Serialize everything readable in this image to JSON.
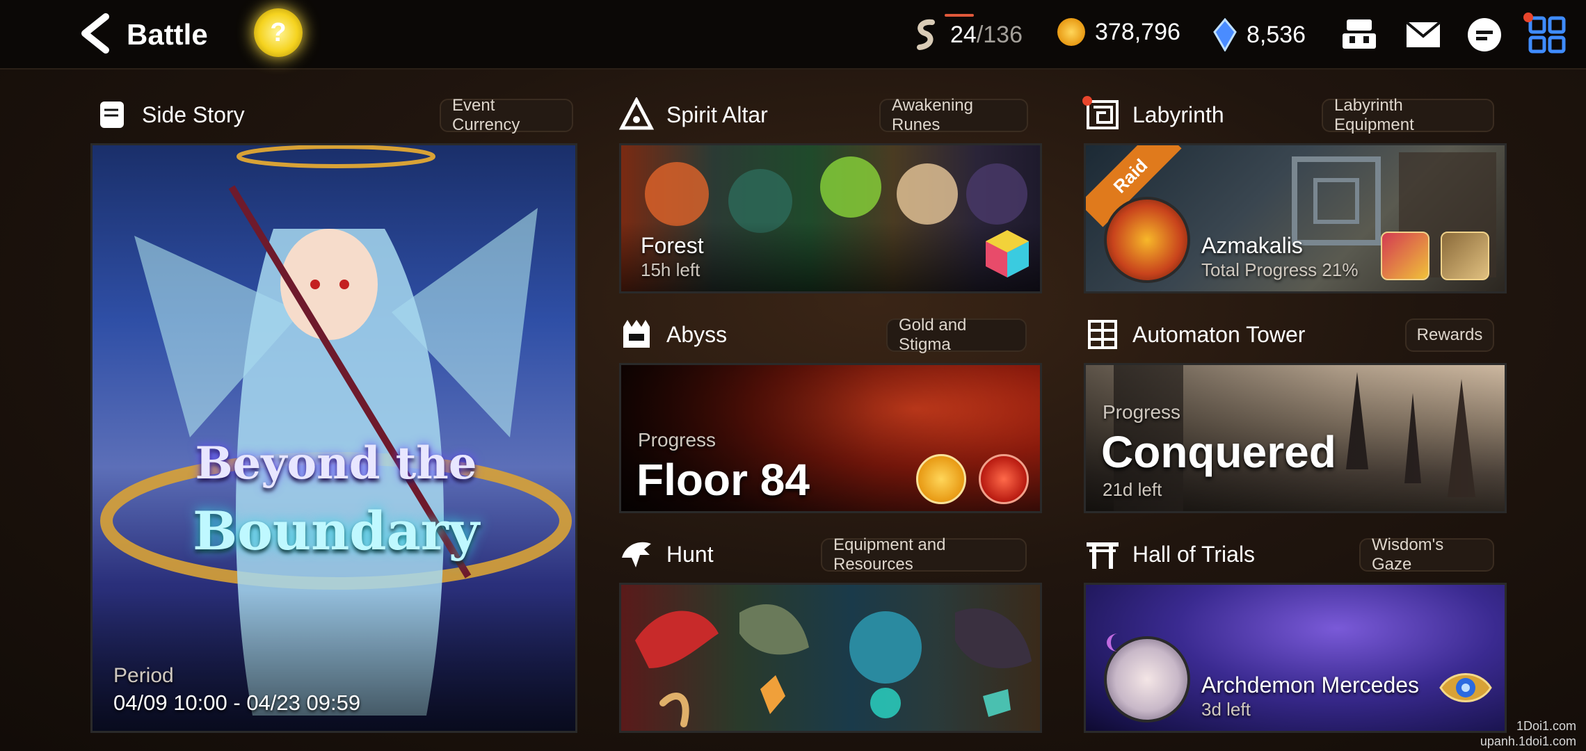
{
  "header": {
    "title": "Battle",
    "help_symbol": "?",
    "stamina": {
      "current": "24",
      "max": "/136"
    },
    "gold": "378,796",
    "crystals": "8,536",
    "icons": [
      "back-arrow-icon",
      "stamina-icon",
      "gold-coin-icon",
      "crystal-icon",
      "team-icon",
      "mail-icon",
      "chat-icon",
      "menu-grid-icon"
    ]
  },
  "side_story": {
    "title": "Side Story",
    "tag": "Event Currency",
    "banner_title_line1": "Beyond the",
    "banner_title_line2": "Boundary",
    "period_label": "Period",
    "period_value": "04/09 10:00 - 04/23 09:59"
  },
  "spirit_altar": {
    "title": "Spirit Altar",
    "tag": "Awakening Runes",
    "element": "Forest",
    "time_left": "15h left"
  },
  "labyrinth": {
    "title": "Labyrinth",
    "tag": "Labyrinth Equipment",
    "ribbon": "Raid",
    "boss": "Azmakalis",
    "progress": "Total Progress 21%"
  },
  "abyss": {
    "title": "Abyss",
    "tag": "Gold and Stigma",
    "progress_label": "Progress",
    "progress_value": "Floor 84"
  },
  "automaton": {
    "title": "Automaton Tower",
    "tag": "Rewards",
    "progress_label": "Progress",
    "progress_value": "Conquered",
    "time_left": "21d left"
  },
  "hunt": {
    "title": "Hunt",
    "tag": "Equipment and Resources"
  },
  "hall_of_trials": {
    "title": "Hall of Trials",
    "tag": "Wisdom's Gaze",
    "boss": "Archdemon Mercedes",
    "time_left": "3d left"
  },
  "watermark": {
    "line1": "1Doi1.com",
    "line2": "upanh.1doi1.com"
  }
}
